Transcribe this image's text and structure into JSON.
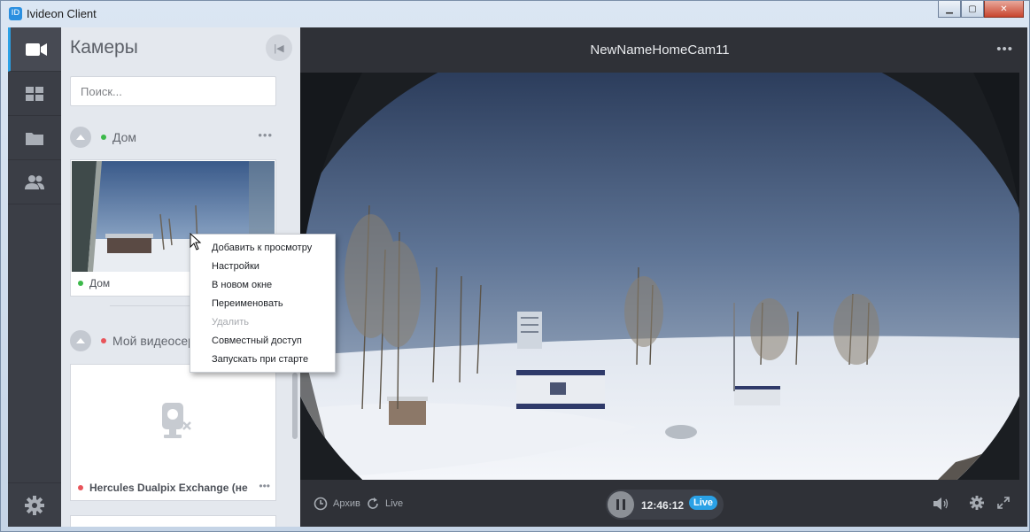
{
  "window": {
    "title": "Ivideon Client",
    "app_icon_glyph": "ID",
    "minimize_glyph": "▁",
    "maximize_glyph": "▢",
    "close_glyph": "✕"
  },
  "nav": {
    "items": [
      {
        "icon": "video-camera-icon"
      },
      {
        "icon": "grid-layout-icon"
      },
      {
        "icon": "folder-icon"
      },
      {
        "icon": "users-icon"
      }
    ],
    "settings_icon": "gear-icon"
  },
  "sidebar": {
    "title": "Камеры",
    "search_placeholder": "Поиск...",
    "collapse_glyph": "|◀",
    "groups": [
      {
        "name": "Дом",
        "status_color": "#3cb94a",
        "more": "•••",
        "cameras": [
          {
            "name": "Дом",
            "status_color": "#3cb94a"
          }
        ]
      },
      {
        "name": "Мой видеосер",
        "status_color": "#e8545a",
        "cameras": [
          {
            "name": "Hercules Dualpix Exchange (не п...",
            "status_color": "#e8545a",
            "more": "•••"
          }
        ]
      }
    ]
  },
  "main": {
    "camera_title": "NewNameHomeCam11",
    "more": "•••",
    "controls": {
      "archive_label": "Архив",
      "live_label": "Live",
      "time": "12:46:12",
      "live_badge": "Live"
    }
  },
  "context_menu": {
    "items": [
      {
        "label": "Добавить к просмотру",
        "enabled": true
      },
      {
        "label": "Настройки",
        "enabled": true
      },
      {
        "label": "В новом окне",
        "enabled": true
      },
      {
        "label": "Переименовать",
        "enabled": true
      },
      {
        "label": "Удалить",
        "enabled": false
      },
      {
        "label": "Совместный доступ",
        "enabled": true
      },
      {
        "label": "Запускать при старте",
        "enabled": true
      }
    ]
  },
  "colors": {
    "accent": "#2aa1e6",
    "online": "#3cb94a",
    "offline": "#e8545a"
  }
}
